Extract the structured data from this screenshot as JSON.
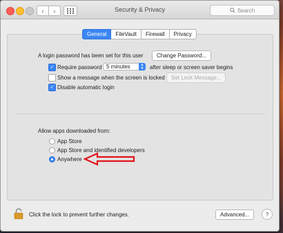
{
  "window": {
    "title": "Security & Privacy",
    "search_placeholder": "Search",
    "nav_back_icon": "chevron-left-icon",
    "nav_forward_icon": "chevron-right-icon",
    "show_all_icon": "grid-icon"
  },
  "tabs": [
    {
      "label": "General",
      "active": true
    },
    {
      "label": "FileVault",
      "active": false
    },
    {
      "label": "Firewall",
      "active": false
    },
    {
      "label": "Privacy",
      "active": false
    }
  ],
  "general": {
    "login_password_text": "A login password has been set for this user",
    "change_password_label": "Change Password...",
    "require_password_label": "Require password",
    "require_password_checked": true,
    "require_password_delay": "5 minutes",
    "after_sleep_text": "after sleep or screen saver begins",
    "show_message_label": "Show a message when the screen is locked",
    "show_message_checked": false,
    "set_lock_message_label": "Set Lock Message...",
    "disable_auto_login_label": "Disable automatic login",
    "disable_auto_login_checked": true
  },
  "allow_apps": {
    "heading": "Allow apps downloaded from:",
    "options": [
      {
        "label": "App Store",
        "selected": false
      },
      {
        "label": "App Store and identified developers",
        "selected": false
      },
      {
        "label": "Anywhere",
        "selected": true
      }
    ]
  },
  "annotation": {
    "arrow_color": "#e0141a"
  },
  "footer": {
    "lock_text": "Click the lock to prevent further changes.",
    "advanced_label": "Advanced...",
    "help_label": "?"
  },
  "colors": {
    "accent": "#3b86f5"
  }
}
